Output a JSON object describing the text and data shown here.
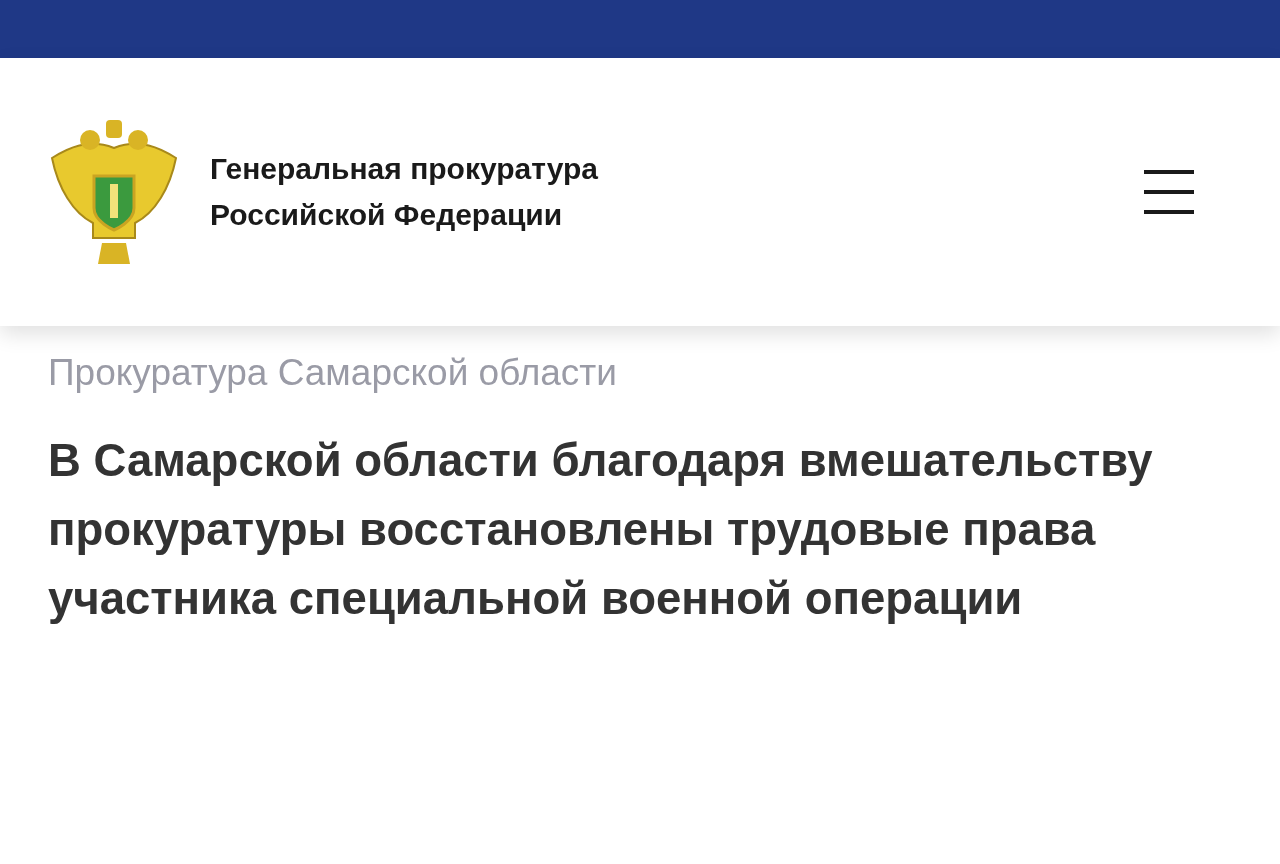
{
  "header": {
    "title_lines": [
      "Генеральная прокуратура",
      "Российской Федерации"
    ]
  },
  "breadcrumb": "Прокуратура Самарской области",
  "headline": "В Самарской области благодаря вмешательству прокуратуры восстановлены трудовые права участника специальной военной операции"
}
